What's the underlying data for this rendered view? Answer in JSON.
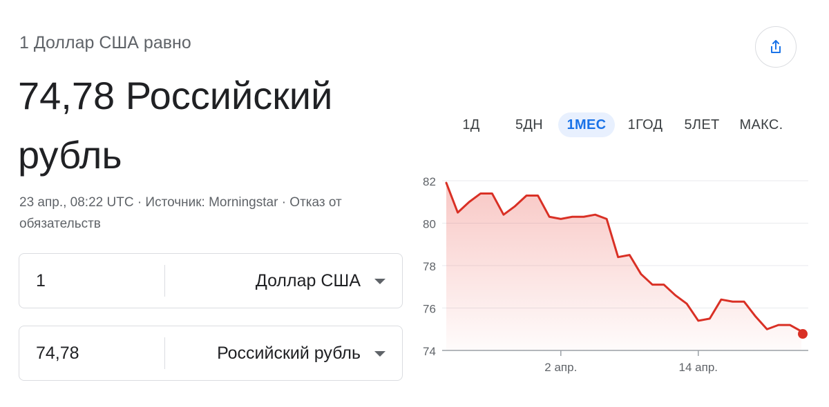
{
  "header": {
    "subtitle": "1 Доллар США равно",
    "main_value": "74,78 Российский рубль",
    "meta": "23 апр., 08:22 UTC · Источник: Morningstar · Отказ от обязательств"
  },
  "converter": {
    "from": {
      "amount": "1",
      "currency": "Доллар США"
    },
    "to": {
      "amount": "74,78",
      "currency": "Российский рубль"
    }
  },
  "share": {
    "icon": "share-icon"
  },
  "range_tabs": [
    {
      "label": "1Д",
      "active": false
    },
    {
      "label": "5ДН",
      "active": false
    },
    {
      "label": "1МЕС",
      "active": true
    },
    {
      "label": "1ГОД",
      "active": false
    },
    {
      "label": "5ЛЕТ",
      "active": false
    },
    {
      "label": "МАКС.",
      "active": false
    }
  ],
  "colors": {
    "line": "#d93025",
    "accent": "#1a73e8",
    "grid": "#e8eaed",
    "axis_text": "#5f6368"
  },
  "chart_data": {
    "type": "area",
    "title": "",
    "xlabel": "",
    "ylabel": "",
    "ylim": [
      74,
      82
    ],
    "yticks": [
      74,
      76,
      78,
      80,
      82
    ],
    "xtick_labels": [
      {
        "x": 10,
        "label": "2 апр."
      },
      {
        "x": 22,
        "label": "14 апр."
      }
    ],
    "series": [
      {
        "values": [
          [
            0,
            81.9
          ],
          [
            1,
            80.5
          ],
          [
            2,
            81.0
          ],
          [
            3,
            81.4
          ],
          [
            4,
            81.4
          ],
          [
            5,
            80.4
          ],
          [
            6,
            80.8
          ],
          [
            7,
            81.3
          ],
          [
            8,
            81.3
          ],
          [
            9,
            80.3
          ],
          [
            10,
            80.2
          ],
          [
            11,
            80.3
          ],
          [
            12,
            80.3
          ],
          [
            13,
            80.4
          ],
          [
            14,
            80.2
          ],
          [
            15,
            78.4
          ],
          [
            16,
            78.5
          ],
          [
            17,
            77.6
          ],
          [
            18,
            77.1
          ],
          [
            19,
            77.1
          ],
          [
            20,
            76.6
          ],
          [
            21,
            76.2
          ],
          [
            22,
            75.4
          ],
          [
            23,
            75.5
          ],
          [
            24,
            76.4
          ],
          [
            25,
            76.3
          ],
          [
            26,
            76.3
          ],
          [
            27,
            75.6
          ],
          [
            28,
            75.0
          ],
          [
            29,
            75.2
          ],
          [
            30,
            75.2
          ],
          [
            31,
            74.9
          ]
        ],
        "last_point": [
          31,
          74.78
        ]
      }
    ],
    "grid": true
  }
}
